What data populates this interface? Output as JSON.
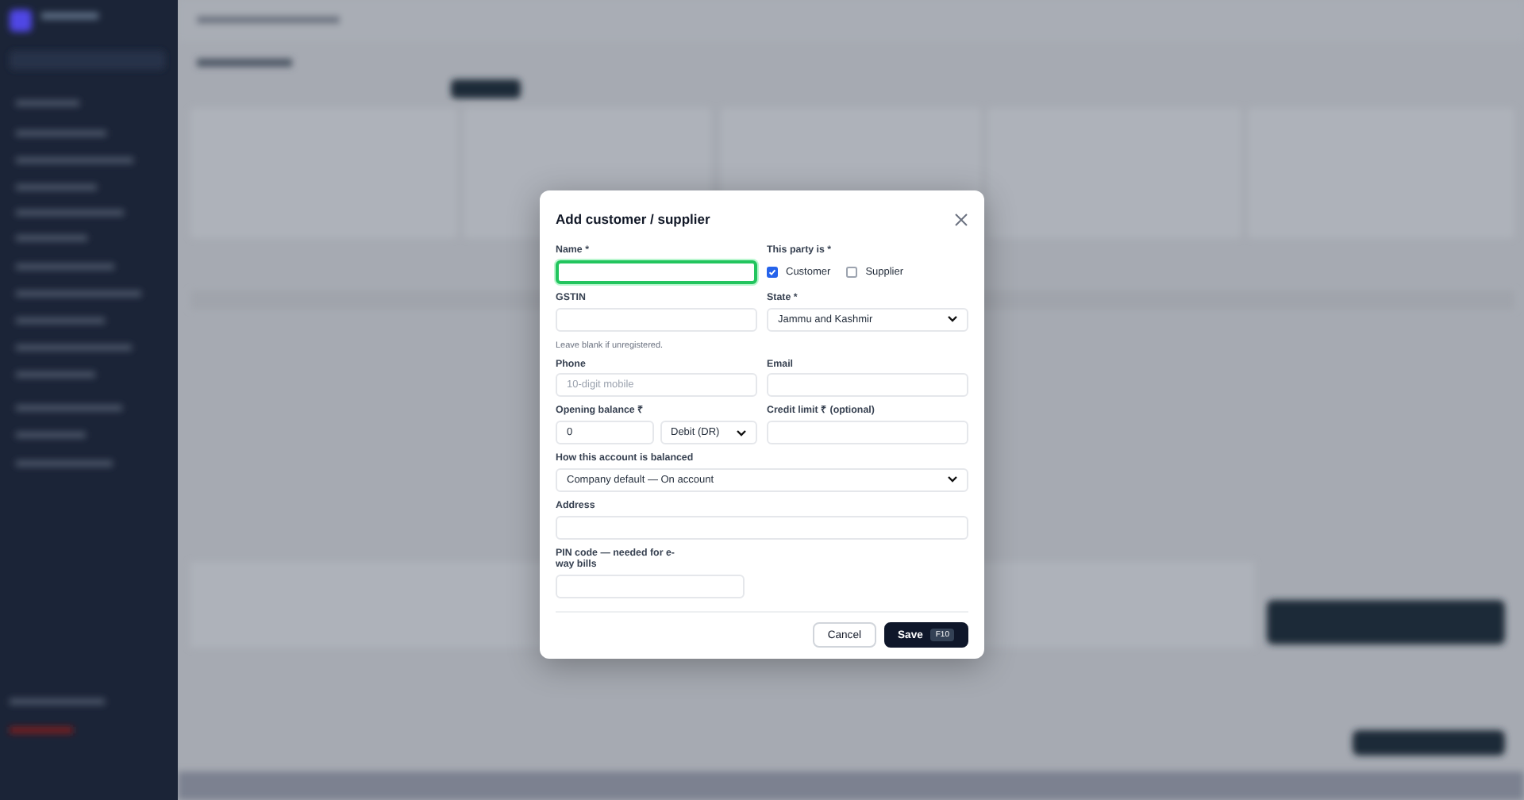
{
  "dialog": {
    "title": "Add customer / supplier",
    "fields": [
      {
        "kind": "text",
        "label": "Name *",
        "focused": true
      },
      {
        "kind": "checks",
        "label": "This party is *",
        "options": [
          {
            "label": "Customer",
            "checked": true
          },
          {
            "label": "Supplier",
            "checked": false
          }
        ]
      },
      {
        "kind": "text",
        "label": "GSTIN",
        "hint": "Leave blank if unregistered.",
        "focused": false
      },
      {
        "kind": "select",
        "label": "State *",
        "value": "Jammu and Kashmir"
      },
      {
        "kind": "text",
        "label": "Phone",
        "placeholder": "10-digit mobile",
        "focused": false
      },
      {
        "kind": "text",
        "label": "Email",
        "focused": false
      },
      {
        "kind": "amount",
        "label": "Opening balance ₹",
        "value": "0",
        "side": "Debit (DR)"
      },
      {
        "kind": "text",
        "label": "Credit limit ₹ (optional)",
        "focused": false
      },
      {
        "kind": "select",
        "label": "How this account is balanced",
        "value": "Company default — On account",
        "wide": true
      },
      {
        "kind": "text",
        "label": "Address",
        "wide": true,
        "focused": false
      },
      {
        "kind": "text",
        "label": "PIN code — needed for e-way bills",
        "focused": false
      }
    ],
    "cancel": "Cancel",
    "save": "Save",
    "save_key": "F10"
  }
}
